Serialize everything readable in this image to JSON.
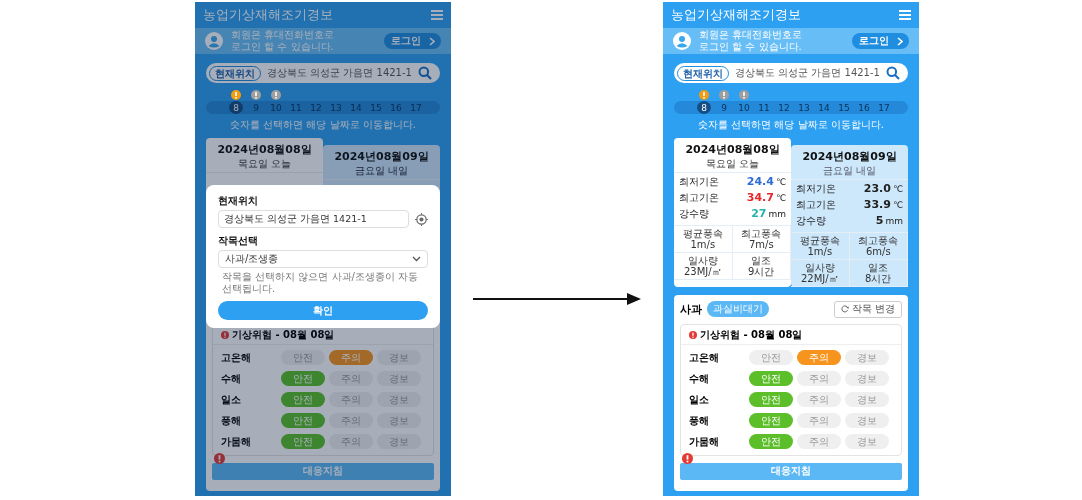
{
  "screens": [
    {
      "dimmed": true,
      "header": {
        "title": "농업기상재해조기경보"
      },
      "login": {
        "message_lines": [
          "회원은 휴대전화번호로",
          "로그인 할 수 있습니다."
        ],
        "button": "로그인"
      },
      "search": {
        "location_button": "현재위치",
        "address": "경상북도 의성군 가음면 1421-1"
      },
      "days": [
        {
          "label": "8",
          "selected": true,
          "color": "#f39c12"
        },
        {
          "label": "9",
          "selected": false,
          "color": "#9e9e9e"
        },
        {
          "label": "10",
          "selected": false,
          "color": "#9e9e9e"
        },
        {
          "label": "11",
          "selected": false
        },
        {
          "label": "12",
          "selected": false
        },
        {
          "label": "13",
          "selected": false
        },
        {
          "label": "14",
          "selected": false
        },
        {
          "label": "15",
          "selected": false
        },
        {
          "label": "16",
          "selected": false
        },
        {
          "label": "17",
          "selected": false
        }
      ],
      "hint": "숫자를 선택하면 해당 날짜로 이동합니다.",
      "forecast": [
        {
          "date": "2024년08월08일",
          "day": "목요일 오늘",
          "selected": true
        },
        {
          "date": "2024년08월09일",
          "day": "금요일 내일",
          "selected": false
        }
      ],
      "risk": {
        "title": "기상위험 - 08월 08일",
        "rows": [
          {
            "name": "고온해",
            "levels": [
              {
                "label": "안전",
                "selected": false
              },
              {
                "kind": "caution",
                "label": "주의",
                "selected": true
              },
              {
                "label": "경보",
                "selected": false
              }
            ]
          },
          {
            "name": "수해",
            "levels": [
              {
                "kind": "safe",
                "label": "안전",
                "selected": true
              },
              {
                "label": "주의",
                "selected": false
              },
              {
                "label": "경보",
                "selected": false
              }
            ]
          },
          {
            "name": "일소",
            "levels": [
              {
                "kind": "safe",
                "label": "안전",
                "selected": true
              },
              {
                "label": "주의",
                "selected": false
              },
              {
                "label": "경보",
                "selected": false
              }
            ]
          },
          {
            "name": "풍해",
            "levels": [
              {
                "kind": "safe",
                "label": "안전",
                "selected": true
              },
              {
                "label": "주의",
                "selected": false
              },
              {
                "label": "경보",
                "selected": false
              }
            ]
          },
          {
            "name": "가뭄해",
            "levels": [
              {
                "kind": "safe",
                "label": "안전",
                "selected": true
              },
              {
                "label": "주의",
                "selected": false
              },
              {
                "label": "경보",
                "selected": false
              }
            ]
          }
        ]
      },
      "guide_button": "대응지침",
      "modal": {
        "location_label": "현재위치",
        "location_value": "경상북도 의성군 가음면 1421-1",
        "crop_label": "작목선택",
        "crop_value": "사과/조생종",
        "note": "작목을 선택하지 않으면 사과/조생종이 자동 선택됩니다.",
        "confirm_button": "확인"
      }
    },
    {
      "dimmed": false,
      "header": {
        "title": "농업기상재해조기경보"
      },
      "login": {
        "message_lines": [
          "회원은 휴대전화번호로",
          "로그인 할 수 있습니다."
        ],
        "button": "로그인"
      },
      "search": {
        "location_button": "현재위치",
        "address": "경상북도 의성군 가음면 1421-1"
      },
      "days": [
        {
          "label": "8",
          "selected": true,
          "color": "#f39c12"
        },
        {
          "label": "9",
          "selected": false,
          "color": "#9e9e9e"
        },
        {
          "label": "10",
          "selected": false,
          "color": "#9e9e9e"
        },
        {
          "label": "11",
          "selected": false
        },
        {
          "label": "12",
          "selected": false
        },
        {
          "label": "13",
          "selected": false
        },
        {
          "label": "14",
          "selected": false
        },
        {
          "label": "15",
          "selected": false
        },
        {
          "label": "16",
          "selected": false
        },
        {
          "label": "17",
          "selected": false
        }
      ],
      "hint": "숫자를 선택하면 해당 날짜로 이동합니다.",
      "forecast": [
        {
          "date": "2024년08월08일",
          "day": "목요일 오늘",
          "selected": true,
          "readings": [
            {
              "kind": "low",
              "label": "최저기온",
              "value": "24.4",
              "unit": "℃"
            },
            {
              "kind": "high",
              "label": "최고기온",
              "value": "34.7",
              "unit": "℃"
            },
            {
              "kind": "rain",
              "label": "강수량",
              "value": "27",
              "unit": "mm"
            }
          ],
          "stats": [
            {
              "label": "평균풍속",
              "value": "1m/s"
            },
            {
              "label": "최고풍속",
              "value": "7m/s"
            },
            {
              "label": "일사량",
              "value": "23MJ/㎡"
            },
            {
              "label": "일조",
              "value": "9시간"
            }
          ]
        },
        {
          "date": "2024년08월09일",
          "day": "금요일 내일",
          "selected": false,
          "readings": [
            {
              "label": "최저기온",
              "value": "23.0",
              "unit": "℃"
            },
            {
              "label": "최고기온",
              "value": "33.9",
              "unit": "℃"
            },
            {
              "label": "강수량",
              "value": "5",
              "unit": "mm"
            }
          ],
          "stats": [
            {
              "label": "평균풍속",
              "value": "1m/s"
            },
            {
              "label": "최고풍속",
              "value": "6m/s"
            },
            {
              "label": "일사량",
              "value": "22MJ/㎡"
            },
            {
              "label": "일조",
              "value": "8시간"
            }
          ]
        }
      ],
      "crop": {
        "name": "사과",
        "stage": "과실비대기",
        "change_button": "작목 변경"
      },
      "risk": {
        "title": "기상위험 - 08월 08일",
        "rows": [
          {
            "name": "고온해",
            "levels": [
              {
                "label": "안전",
                "selected": false
              },
              {
                "kind": "caution",
                "label": "주의",
                "selected": true
              },
              {
                "label": "경보",
                "selected": false
              }
            ]
          },
          {
            "name": "수해",
            "levels": [
              {
                "kind": "safe",
                "label": "안전",
                "selected": true
              },
              {
                "label": "주의",
                "selected": false
              },
              {
                "label": "경보",
                "selected": false
              }
            ]
          },
          {
            "name": "일소",
            "levels": [
              {
                "kind": "safe",
                "label": "안전",
                "selected": true
              },
              {
                "label": "주의",
                "selected": false
              },
              {
                "label": "경보",
                "selected": false
              }
            ]
          },
          {
            "name": "풍해",
            "levels": [
              {
                "kind": "safe",
                "label": "안전",
                "selected": true
              },
              {
                "label": "주의",
                "selected": false
              },
              {
                "label": "경보",
                "selected": false
              }
            ]
          },
          {
            "name": "가뭄해",
            "levels": [
              {
                "kind": "safe",
                "label": "안전",
                "selected": true
              },
              {
                "label": "주의",
                "selected": false
              },
              {
                "label": "경보",
                "selected": false
              }
            ]
          }
        ]
      },
      "guide_button": "대응지침"
    }
  ]
}
